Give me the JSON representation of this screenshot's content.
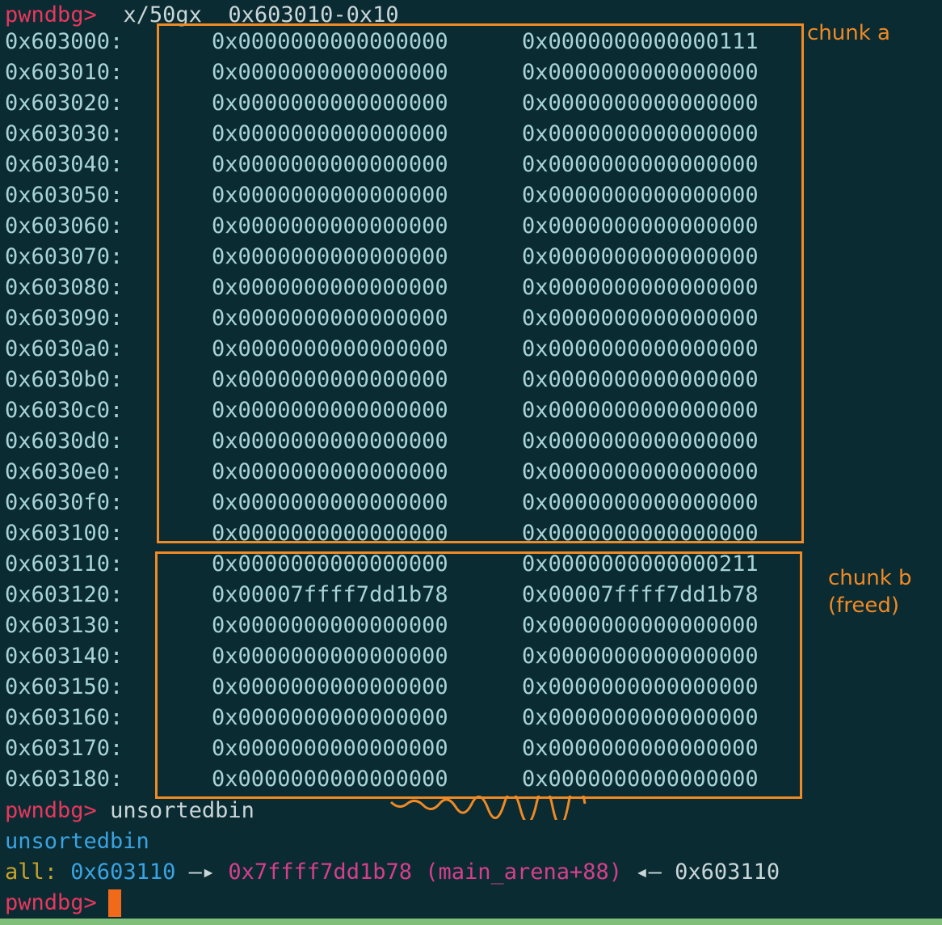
{
  "prompt": "pwndbg>",
  "command1": "x/50gx  0x603010-0x10",
  "rows": [
    {
      "addr": "0x603000:",
      "v1": "0x0000000000000000",
      "v2": "0x0000000000000111"
    },
    {
      "addr": "0x603010:",
      "v1": "0x0000000000000000",
      "v2": "0x0000000000000000"
    },
    {
      "addr": "0x603020:",
      "v1": "0x0000000000000000",
      "v2": "0x0000000000000000"
    },
    {
      "addr": "0x603030:",
      "v1": "0x0000000000000000",
      "v2": "0x0000000000000000"
    },
    {
      "addr": "0x603040:",
      "v1": "0x0000000000000000",
      "v2": "0x0000000000000000"
    },
    {
      "addr": "0x603050:",
      "v1": "0x0000000000000000",
      "v2": "0x0000000000000000"
    },
    {
      "addr": "0x603060:",
      "v1": "0x0000000000000000",
      "v2": "0x0000000000000000"
    },
    {
      "addr": "0x603070:",
      "v1": "0x0000000000000000",
      "v2": "0x0000000000000000"
    },
    {
      "addr": "0x603080:",
      "v1": "0x0000000000000000",
      "v2": "0x0000000000000000"
    },
    {
      "addr": "0x603090:",
      "v1": "0x0000000000000000",
      "v2": "0x0000000000000000"
    },
    {
      "addr": "0x6030a0:",
      "v1": "0x0000000000000000",
      "v2": "0x0000000000000000"
    },
    {
      "addr": "0x6030b0:",
      "v1": "0x0000000000000000",
      "v2": "0x0000000000000000"
    },
    {
      "addr": "0x6030c0:",
      "v1": "0x0000000000000000",
      "v2": "0x0000000000000000"
    },
    {
      "addr": "0x6030d0:",
      "v1": "0x0000000000000000",
      "v2": "0x0000000000000000"
    },
    {
      "addr": "0x6030e0:",
      "v1": "0x0000000000000000",
      "v2": "0x0000000000000000"
    },
    {
      "addr": "0x6030f0:",
      "v1": "0x0000000000000000",
      "v2": "0x0000000000000000"
    },
    {
      "addr": "0x603100:",
      "v1": "0x0000000000000000",
      "v2": "0x0000000000000000"
    },
    {
      "addr": "0x603110:",
      "v1": "0x0000000000000000",
      "v2": "0x0000000000000211"
    },
    {
      "addr": "0x603120:",
      "v1": "0x00007ffff7dd1b78",
      "v2": "0x00007ffff7dd1b78"
    },
    {
      "addr": "0x603130:",
      "v1": "0x0000000000000000",
      "v2": "0x0000000000000000"
    },
    {
      "addr": "0x603140:",
      "v1": "0x0000000000000000",
      "v2": "0x0000000000000000"
    },
    {
      "addr": "0x603150:",
      "v1": "0x0000000000000000",
      "v2": "0x0000000000000000"
    },
    {
      "addr": "0x603160:",
      "v1": "0x0000000000000000",
      "v2": "0x0000000000000000"
    },
    {
      "addr": "0x603170:",
      "v1": "0x0000000000000000",
      "v2": "0x0000000000000000"
    },
    {
      "addr": "0x603180:",
      "v1": "0x0000000000000000",
      "v2": "0x0000000000000000"
    }
  ],
  "command2": "unsortedbin",
  "bin_header": "unsortedbin",
  "bin_line": {
    "label": "all:",
    "addr1": "0x603110",
    "arrow1": "—▸",
    "addr2": "0x7ffff7dd1b78",
    "symbol": "(main_arena+88)",
    "arrow2": "◂—",
    "addr3": "0x603110"
  },
  "annotations": {
    "chunk_a": "chunk a",
    "chunk_b": "chunk b\n(freed)"
  },
  "colors": {
    "background": "#0b2b33",
    "prompt": "#e8375d",
    "annotation": "#f08a24",
    "blue": "#3aa3e0",
    "magenta": "#d63f8c",
    "gold": "#c9a227",
    "status_bar": "#7fbf7a"
  }
}
